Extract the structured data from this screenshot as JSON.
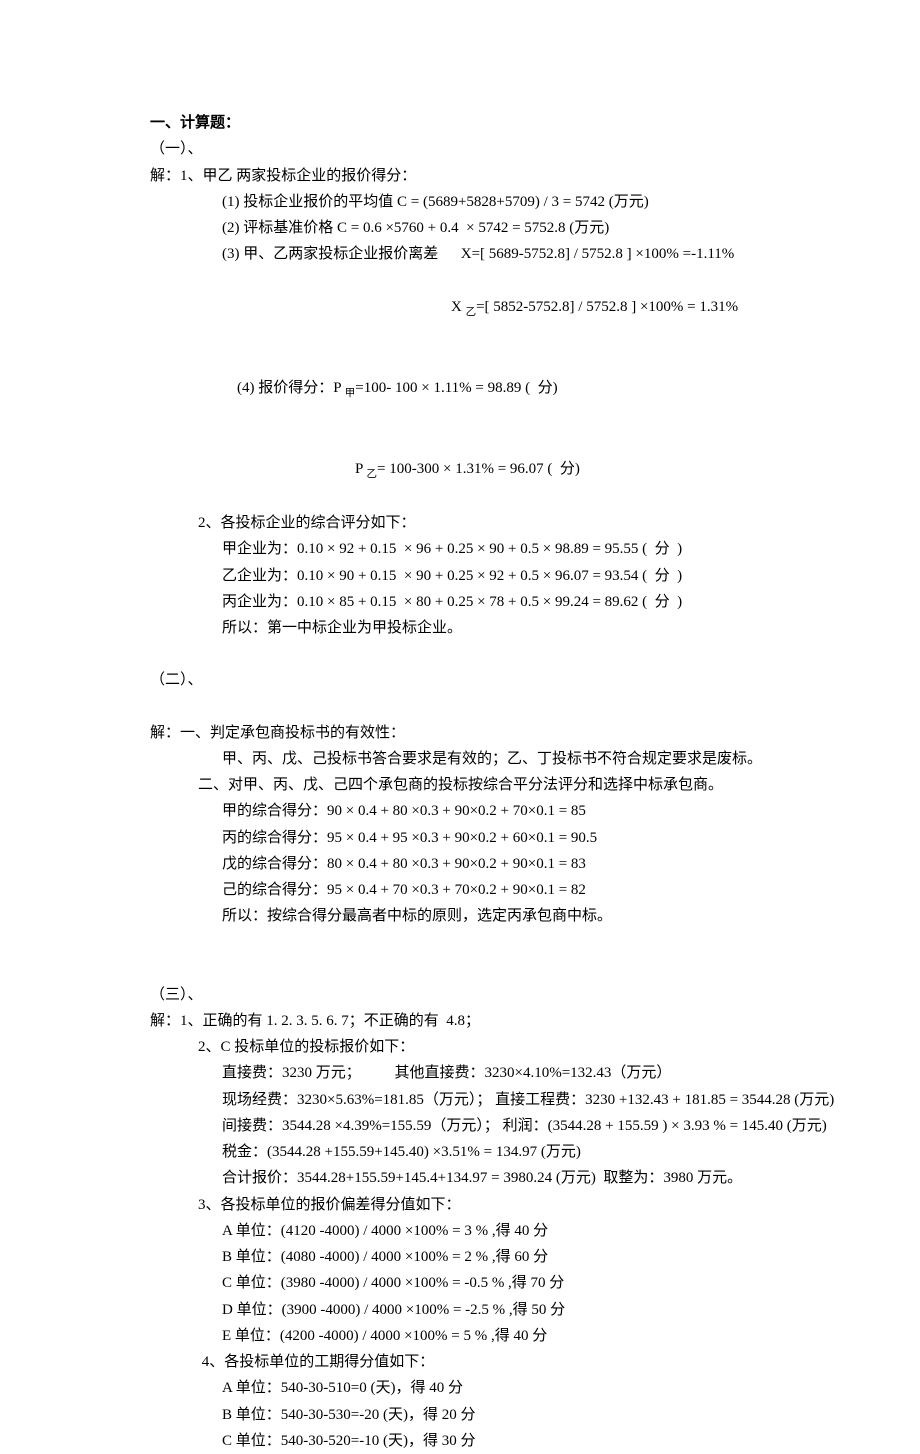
{
  "section1": {
    "heading": "一、计算题：",
    "sub1_label": "（一）、",
    "q1_intro": "解：1、甲乙 两家投标企业的报价得分：",
    "q1_1": "(1) 投标企业报价的平均值 C = (5689+5828+5709) / 3 = 5742 (万元)",
    "q1_2": "(2) 评标基准价格 C = 0.6 ×5760 + 0.4  × 5742 = 5752.8 (万元)",
    "q1_3a": "(3) 甲、乙两家投标企业报价离差      X=[ 5689-5752.8] / 5752.8 ] ×100% =-1.11%",
    "q1_3b_prefix": "X ",
    "q1_3b_sub": "乙",
    "q1_3b_rest": "=[ 5852-5752.8] / 5752.8 ] ×100% = 1.31%",
    "q1_4a_prefix": "(4) 报价得分：P ",
    "q1_4a_sub": "甲",
    "q1_4a_rest": "=100- 100 × 1.11% = 98.89 (  分)",
    "q1_4b_prefix": "P ",
    "q1_4b_sub": "乙",
    "q1_4b_rest": "= 100-300 × 1.31% = 96.07 (  分)",
    "q2_intro": "2、各投标企业的综合评分如下：",
    "q2_a": "甲企业为：0.10 × 92 + 0.15  × 96 + 0.25 × 90 + 0.5 × 98.89 = 95.55 (  分  )",
    "q2_b": "乙企业为：0.10 × 90 + 0.15  × 90 + 0.25 × 92 + 0.5 × 96.07 = 93.54 (  分  )",
    "q2_c": "丙企业为：0.10 × 85 + 0.15  × 80 + 0.25 × 78 + 0.5 × 99.24 = 89.62 (  分  )",
    "q2_concl": "所以：第一中标企业为甲投标企业。",
    "sub2_label": "（二）、",
    "p2_intro": "解：一、判定承包商投标书的有效性：",
    "p2_validity": "甲、丙、戊、己投标书答合要求是有效的；乙、丁投标书不符合规定要求是废标。",
    "p2_method": "二、对甲、丙、戊、己四个承包商的投标按综合平分法评分和选择中标承包商。",
    "p2_a": "甲的综合得分：90 × 0.4 + 80 ×0.3 + 90×0.2 + 70×0.1 = 85",
    "p2_b": "丙的综合得分：95 × 0.4 + 95 ×0.3 + 90×0.2 + 60×0.1 = 90.5",
    "p2_c": "戊的综合得分：80 × 0.4 + 80 ×0.3 + 90×0.2 + 90×0.1 = 83",
    "p2_d": "己的综合得分：95 × 0.4 + 70 ×0.3 + 70×0.2 + 90×0.1 = 82",
    "p2_concl": "所以：按综合得分最高者中标的原则，选定丙承包商中标。",
    "sub3_label": "（三）、",
    "p3_q1": "解：1、正确的有 1. 2. 3. 5. 6. 7；不正确的有  4.8；",
    "p3_q2_intro": "2、C 投标单位的投标报价如下：",
    "p3_q2_a": "直接费：3230 万元；         其他直接费：3230×4.10%=132.43（万元）",
    "p3_q2_b": "现场经费：3230×5.63%=181.85（万元）； 直接工程费：3230 +132.43 + 181.85 = 3544.28 (万元)",
    "p3_q2_c": "间接费：3544.28 ×4.39%=155.59（万元）； 利润：(3544.28 + 155.59 ) × 3.93 % = 145.40 (万元)",
    "p3_q2_d": "税金：(3544.28 +155.59+145.40) ×3.51% = 134.97 (万元)",
    "p3_q2_e": "合计报价：3544.28+155.59+145.4+134.97 = 3980.24 (万元)  取整为：3980 万元。",
    "p3_q3_intro": "3、各投标单位的报价偏差得分值如下：",
    "p3_q3_a": "A 单位：(4120 -4000) / 4000 ×100% = 3 % ,得 40 分",
    "p3_q3_b": "B 单位：(4080 -4000) / 4000 ×100% = 2 % ,得 60 分",
    "p3_q3_c": "C 单位：(3980 -4000) / 4000 ×100% = -0.5 % ,得 70 分",
    "p3_q3_d": "D 单位：(3900 -4000) / 4000 ×100% = -2.5 % ,得 50 分",
    "p3_q3_e": "E 单位：(4200 -4000) / 4000 ×100% = 5 % ,得 40 分",
    "p3_q4_intro": " 4、各投标单位的工期得分值如下：",
    "p3_q4_a": "A 单位：540-30-510=0 (天)，得 40 分",
    "p3_q4_b": "B 单位：540-30-530=-20 (天)，得 20 分",
    "p3_q4_c": "C 单位：540-30-520=-10 (天)，得 30 分"
  }
}
